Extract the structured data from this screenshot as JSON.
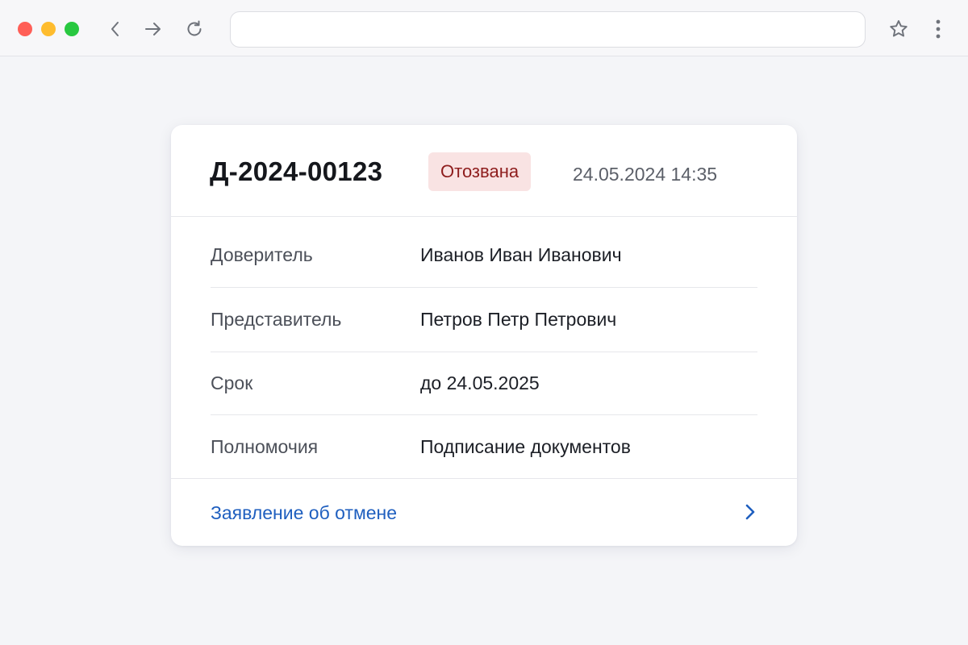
{
  "browser": {
    "address_value": "",
    "icons": {
      "back": "chevron-left-icon",
      "forward": "arrow-right-icon",
      "reload": "reload-icon",
      "bookmark": "star-icon",
      "menu": "kebab-menu-icon"
    },
    "colors": {
      "close": "#ff5f57",
      "minimize": "#febc2e",
      "maximize": "#28c840"
    }
  },
  "document": {
    "number": "Д-2024-00123",
    "status": "Отозвана",
    "status_color": "#8e1d1d",
    "status_background": "#f9e3e3",
    "datetime": "24.05.2024 14:35"
  },
  "details": [
    {
      "label": "Доверитель",
      "value": "Иванов Иван Иванович"
    },
    {
      "label": "Представитель",
      "value": "Петров Петр Петрович"
    },
    {
      "label": "Срок",
      "value": "до 24.05.2025"
    },
    {
      "label": "Полномочия",
      "value": "Подписание документов"
    }
  ],
  "footer": {
    "link_label": "Заявление об отмене",
    "link_color": "#1f5fbf",
    "icon": "chevron-right-icon"
  }
}
